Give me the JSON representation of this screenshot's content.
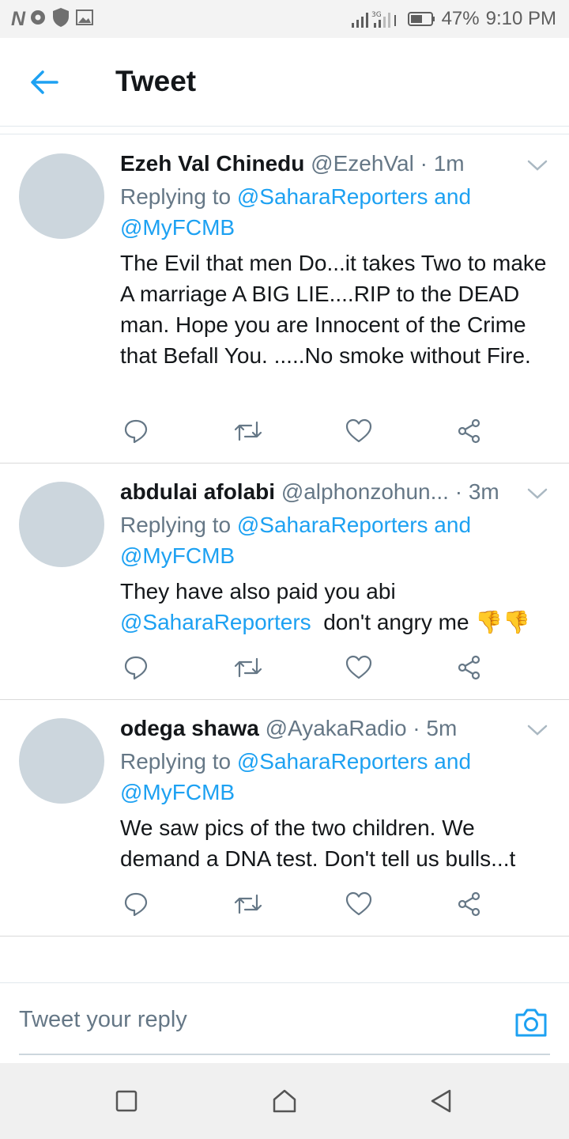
{
  "status_bar": {
    "carrier_glyph": "N",
    "network_label": "3G",
    "battery": "47%",
    "time": "9:10 PM",
    "icons": [
      "vpn-icon",
      "shield-icon",
      "image-icon",
      "signal-icon",
      "battery-icon"
    ]
  },
  "header": {
    "title": "Tweet",
    "back_icon": "arrow-left-icon",
    "accent_color": "#1da1f2"
  },
  "tweets": [
    {
      "name": "Ezeh Val Chinedu",
      "meta": "@EzehVal · 1m",
      "replying_prefix": "Replying to ",
      "replying_mention": "@SaharaReporters",
      "replying_and": " and",
      "replying_mention2": "@MyFCMB",
      "text": "The Evil that men Do...it takes Two to make A marriage A BIG LIE....RIP to the DEAD man. Hope you are Innocent of the Crime that Befall You. .....No smoke without Fire."
    },
    {
      "name": "abdulai afolabi",
      "meta": "@alphonzohun... · 3m",
      "replying_prefix": "Replying to ",
      "replying_mention": "@SaharaReporters",
      "replying_and": " and",
      "replying_mention2": "@MyFCMB",
      "text_part1": "They have also paid you abi",
      "text_mention": "@SaharaReporters",
      "text_part2": "  don't angry me 👎👎"
    },
    {
      "name": "odega shawa",
      "meta": "@AyakaRadio · 5m",
      "replying_prefix": "Replying to ",
      "replying_mention": "@SaharaReporters",
      "replying_and": " and",
      "replying_mention2": "@MyFCMB",
      "text": "We saw pics of the two children. We demand a DNA test. Don't tell us bulls...t"
    }
  ],
  "action_icons": [
    "reply-icon",
    "retweet-icon",
    "like-icon",
    "share-icon"
  ],
  "reply_bar": {
    "placeholder": "Tweet your reply",
    "camera_icon": "camera-icon"
  },
  "nav_bar": {
    "icons": [
      "recents-icon",
      "home-icon",
      "back-icon"
    ]
  }
}
